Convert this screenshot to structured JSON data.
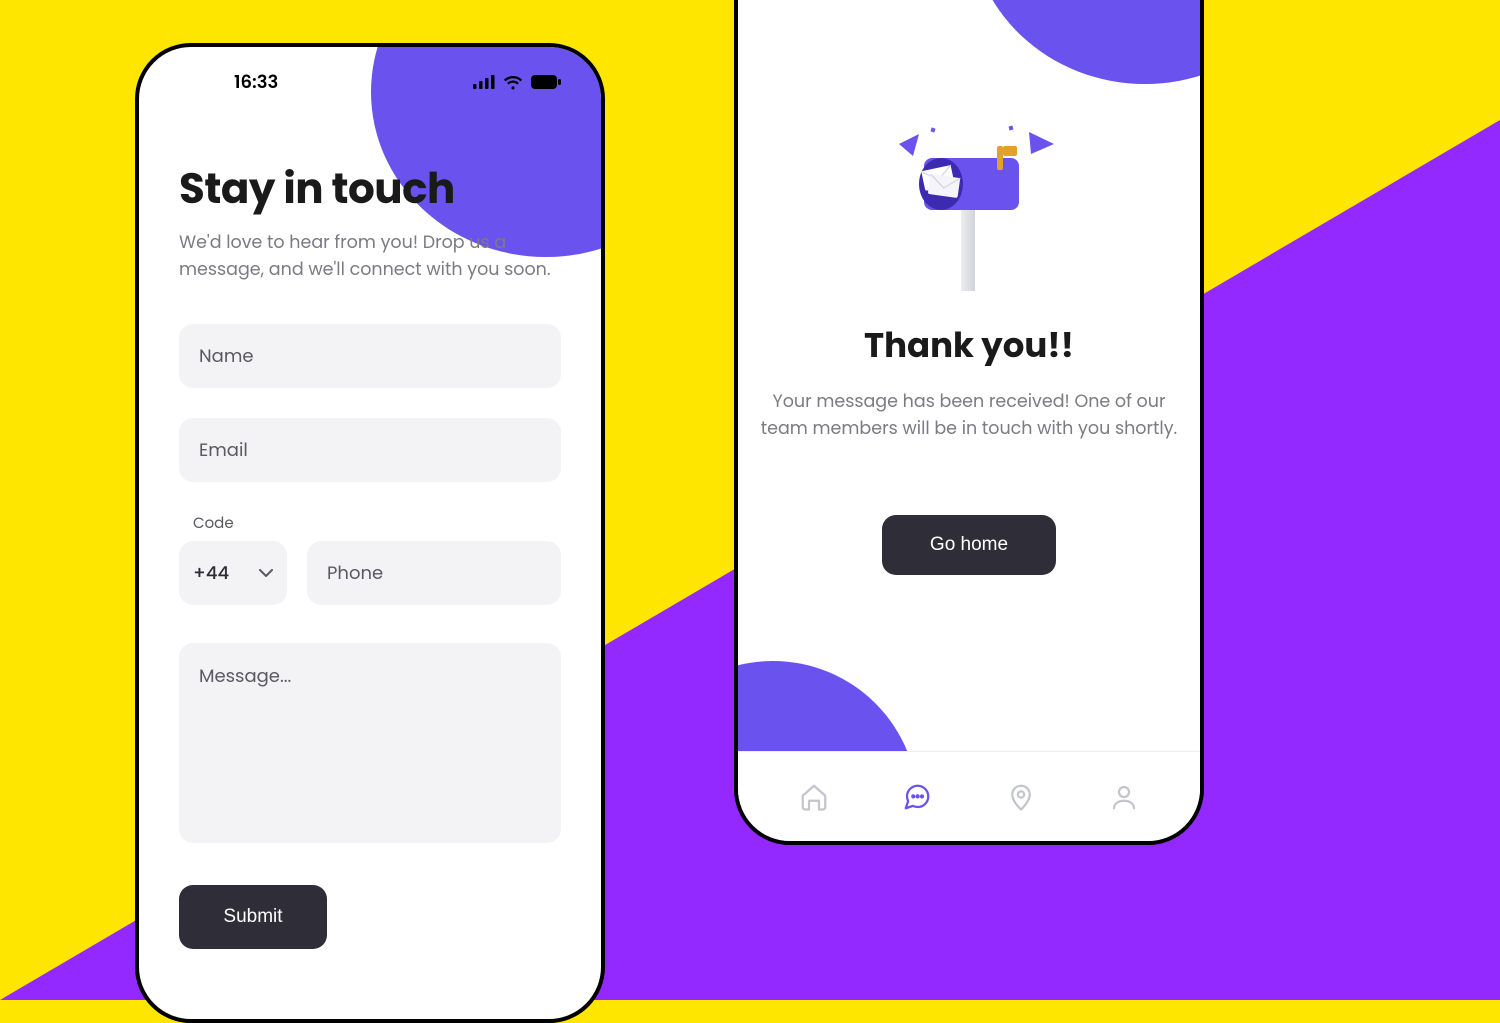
{
  "colors": {
    "accent": "#6a52ee",
    "bgYellow": "#fee600",
    "bgPurple": "#9429ff",
    "dark": "#2e2d38",
    "field": "#f3f3f5",
    "text": "#1a1a1a",
    "muted": "#7b7a85"
  },
  "statusBar": {
    "time": "16:33"
  },
  "contactScreen": {
    "title": "Stay in touch",
    "subtitle": "We'd love to hear from you! Drop us a message, and we'll connect with you soon.",
    "fields": {
      "name_placeholder": "Name",
      "email_placeholder": "Email",
      "code_label": "Code",
      "code_value": "+44",
      "phone_placeholder": "Phone",
      "message_placeholder": "Message..."
    },
    "submit_label": "Submit"
  },
  "thankYouScreen": {
    "title": "Thank you!!",
    "subtitle": "Your message has been received! One of our team members will be in touch with you shortly.",
    "goHome_label": "Go home",
    "nav": {
      "items": [
        "home",
        "chat",
        "location",
        "profile"
      ],
      "activeIndex": 1
    }
  }
}
